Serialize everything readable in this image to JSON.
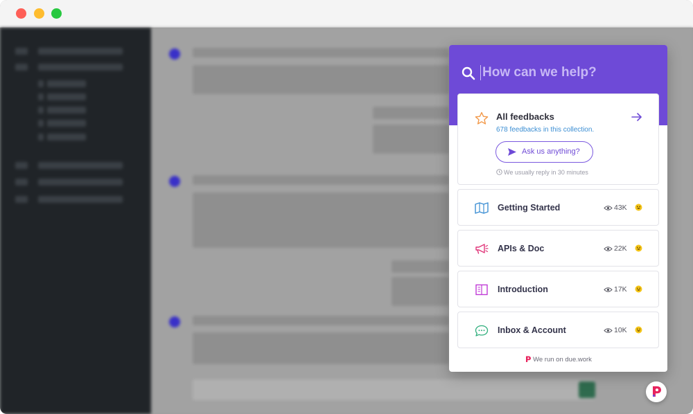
{
  "window": {
    "controls": [
      "close",
      "minimize",
      "maximize"
    ]
  },
  "search": {
    "placeholder": "How can we help?",
    "icon": "search-icon"
  },
  "featured": {
    "title": "All feedbacks",
    "subtitle": "678 feedbacks in this collection.",
    "ask_label": "Ask us anything?",
    "reply_note": "We usually reply in 30 minutes",
    "icon": "star-icon",
    "accent": "#f2994a"
  },
  "categories": [
    {
      "label": "Getting Started",
      "views": "43K",
      "icon": "map-icon",
      "color": "#3b8ed3"
    },
    {
      "label": "APIs & Doc",
      "views": "22K",
      "icon": "megaphone-icon",
      "color": "#e0377a"
    },
    {
      "label": "Introduction",
      "views": "17K",
      "icon": "book-icon",
      "color": "#c03ad6"
    },
    {
      "label": "Inbox & Account",
      "views": "10K",
      "icon": "chat-bubble-icon",
      "color": "#2fae7c"
    }
  ],
  "footer": {
    "text": "We run on due.work"
  },
  "colors": {
    "brand": "#6e4ad7",
    "link": "#3b8ed3",
    "logo": "#e8245e"
  }
}
